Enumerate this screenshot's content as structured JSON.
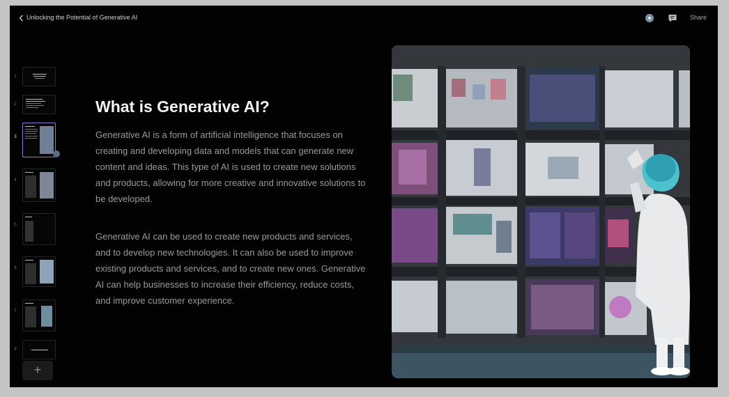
{
  "header": {
    "title": "Unlocking the Potential of Generative AI",
    "share_label": "Share",
    "icons": {
      "back": "chevron-left-icon",
      "avatar": "user-avatar",
      "comment": "comment-icon"
    }
  },
  "sidebar": {
    "slides": [
      {
        "number": "1"
      },
      {
        "number": "2"
      },
      {
        "number": "3",
        "active": true
      },
      {
        "number": "4"
      },
      {
        "number": "5"
      },
      {
        "number": "6"
      },
      {
        "number": "7"
      },
      {
        "number": "8"
      }
    ],
    "add_label": "+"
  },
  "slide": {
    "title": "What is Generative AI?",
    "paragraphs": [
      "Generative AI is a form of artificial intelligence that focuses on creating and developing data and models that can generate new content and ideas. This type of AI is used to create new solutions and products, allowing for more creative and innovative solutions to be developed.",
      "Generative AI can be used to create new products and services, and to develop new technologies. It can also be used to improve existing products and services, and to create new ones. Generative AI can help businesses to increase their efficiency, reduce costs, and improve customer experience."
    ]
  },
  "colors": {
    "background": "#020202",
    "title": "#f2f2f2",
    "body_text": "#9a9a9a",
    "active_thumb_border": "#8e78d8"
  }
}
